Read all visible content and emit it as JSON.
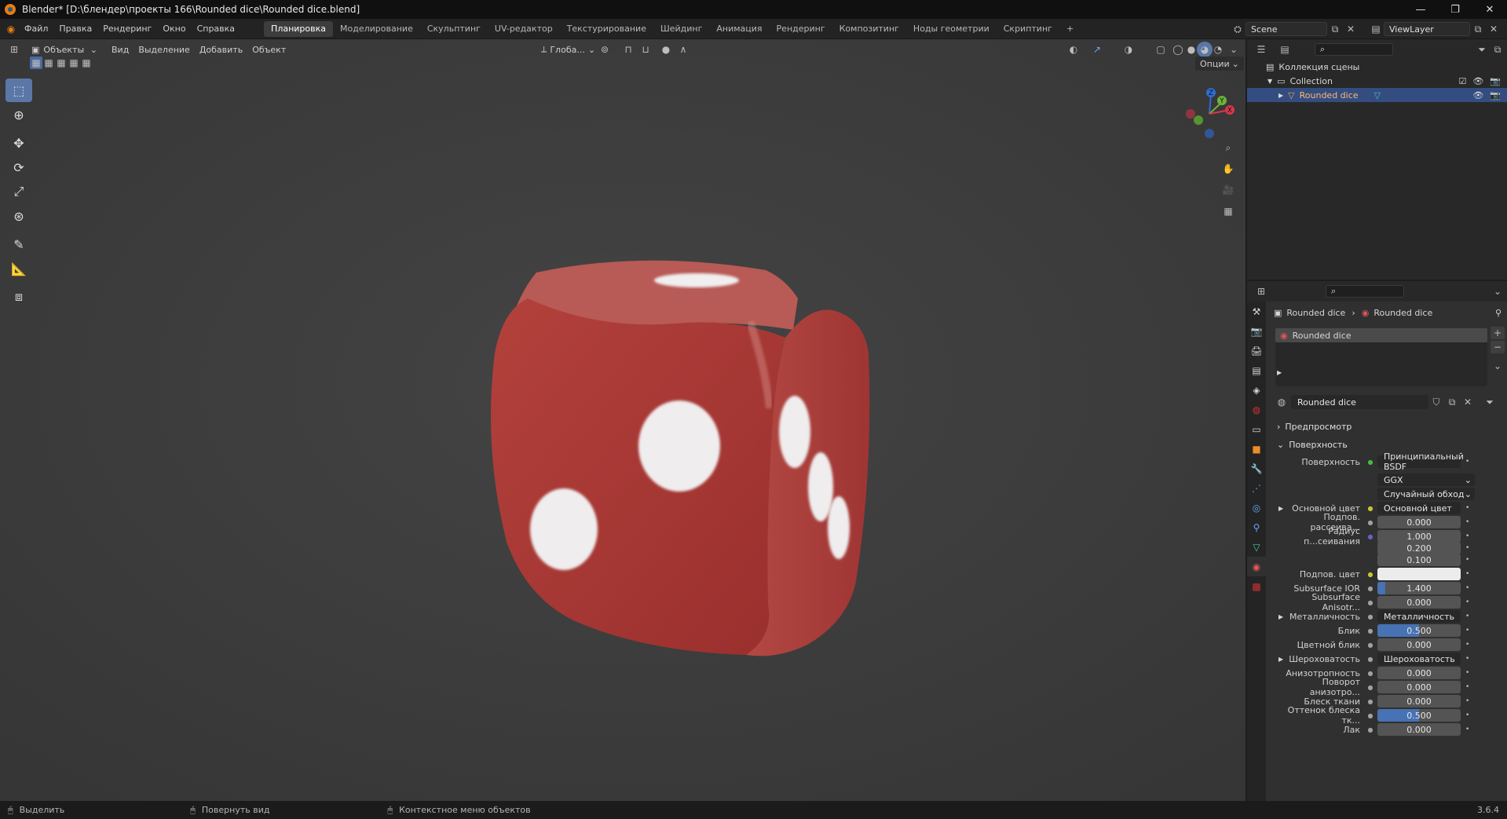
{
  "window": {
    "title": "Blender* [D:\\блендер\\проекты 166\\Rounded dice\\Rounded dice.blend]",
    "controls": [
      "—",
      "❐",
      "✕"
    ]
  },
  "menu": [
    "Файл",
    "Правка",
    "Рендеринг",
    "Окно",
    "Справка"
  ],
  "workspaces": [
    "Планировка",
    "Моделирование",
    "Скульптинг",
    "UV-редактор",
    "Текстурирование",
    "Шейдинг",
    "Анимация",
    "Рендеринг",
    "Композитинг",
    "Ноды геометрии",
    "Скриптинг"
  ],
  "workspace_add": "+",
  "scene": {
    "name": "Scene",
    "view_layer": "ViewLayer"
  },
  "viewport": {
    "mode": "Объекты",
    "menus": [
      "Вид",
      "Выделение",
      "Добавить",
      "Объект"
    ],
    "transform_orientation": "Глоба...",
    "options": "Опции"
  },
  "gizmo": {
    "z": "Z",
    "y": "Y",
    "x": "X"
  },
  "outliner": {
    "scene_collection": "Коллекция сцены",
    "collection": "Collection",
    "object": "Rounded dice"
  },
  "properties": {
    "breadcrumb_object": "Rounded dice",
    "breadcrumb_material": "Rounded dice",
    "slot_name": "Rounded dice",
    "material_name": "Rounded dice",
    "sections": {
      "preview": "Предпросмотр",
      "surface": "Поверхность"
    },
    "rows": [
      {
        "label": "Поверхность",
        "value": "Принципиальный BSDF",
        "kind": "link",
        "dot": "#3fbf3f"
      },
      {
        "label": "",
        "value": "GGX",
        "kind": "dropdown"
      },
      {
        "label": "",
        "value": "Случайный обход",
        "kind": "dropdown"
      },
      {
        "label": "Основной цвет",
        "value": "Основной цвет",
        "kind": "link",
        "dot": "#c7c729",
        "expand": true
      },
      {
        "label": "Подпов. рассеива...",
        "value": "0.000",
        "kind": "num",
        "dot": "#a1a1a1"
      },
      {
        "label": "Радиус п...сеивания",
        "value": "1.000",
        "kind": "num",
        "dot": "#6363c7"
      },
      {
        "label": "",
        "value": "0.200",
        "kind": "num"
      },
      {
        "label": "",
        "value": "0.100",
        "kind": "num"
      },
      {
        "label": "Подпов. цвет",
        "value": "",
        "kind": "color",
        "dot": "#c7c729"
      },
      {
        "label": "Subsurface IOR",
        "value": "1.400",
        "kind": "num",
        "dot": "#a1a1a1",
        "fill": 0.09
      },
      {
        "label": "Subsurface Anisotr...",
        "value": "0.000",
        "kind": "num",
        "dot": "#a1a1a1"
      },
      {
        "label": "Металличность",
        "value": "Металличность",
        "kind": "link",
        "dot": "#a1a1a1",
        "expand": true
      },
      {
        "label": "Блик",
        "value": "0.500",
        "kind": "num",
        "dot": "#a1a1a1",
        "fill": 0.5
      },
      {
        "label": "Цветной блик",
        "value": "0.000",
        "kind": "num",
        "dot": "#a1a1a1"
      },
      {
        "label": "Шероховатость",
        "value": "Шероховатость",
        "kind": "link",
        "dot": "#a1a1a1",
        "expand": true
      },
      {
        "label": "Анизотропность",
        "value": "0.000",
        "kind": "num",
        "dot": "#a1a1a1"
      },
      {
        "label": "Поворот анизотро...",
        "value": "0.000",
        "kind": "num",
        "dot": "#a1a1a1"
      },
      {
        "label": "Блеск ткани",
        "value": "0.000",
        "kind": "num",
        "dot": "#a1a1a1"
      },
      {
        "label": "Оттенок блеска тк...",
        "value": "0.500",
        "kind": "num",
        "dot": "#a1a1a1",
        "fill": 0.5
      },
      {
        "label": "Лак",
        "value": "0.000",
        "kind": "num",
        "dot": "#a1a1a1"
      }
    ]
  },
  "statusbar": {
    "select": "Выделить",
    "rotate": "Повернуть вид",
    "context": "Контекстное меню объектов",
    "version": "3.6.4"
  }
}
